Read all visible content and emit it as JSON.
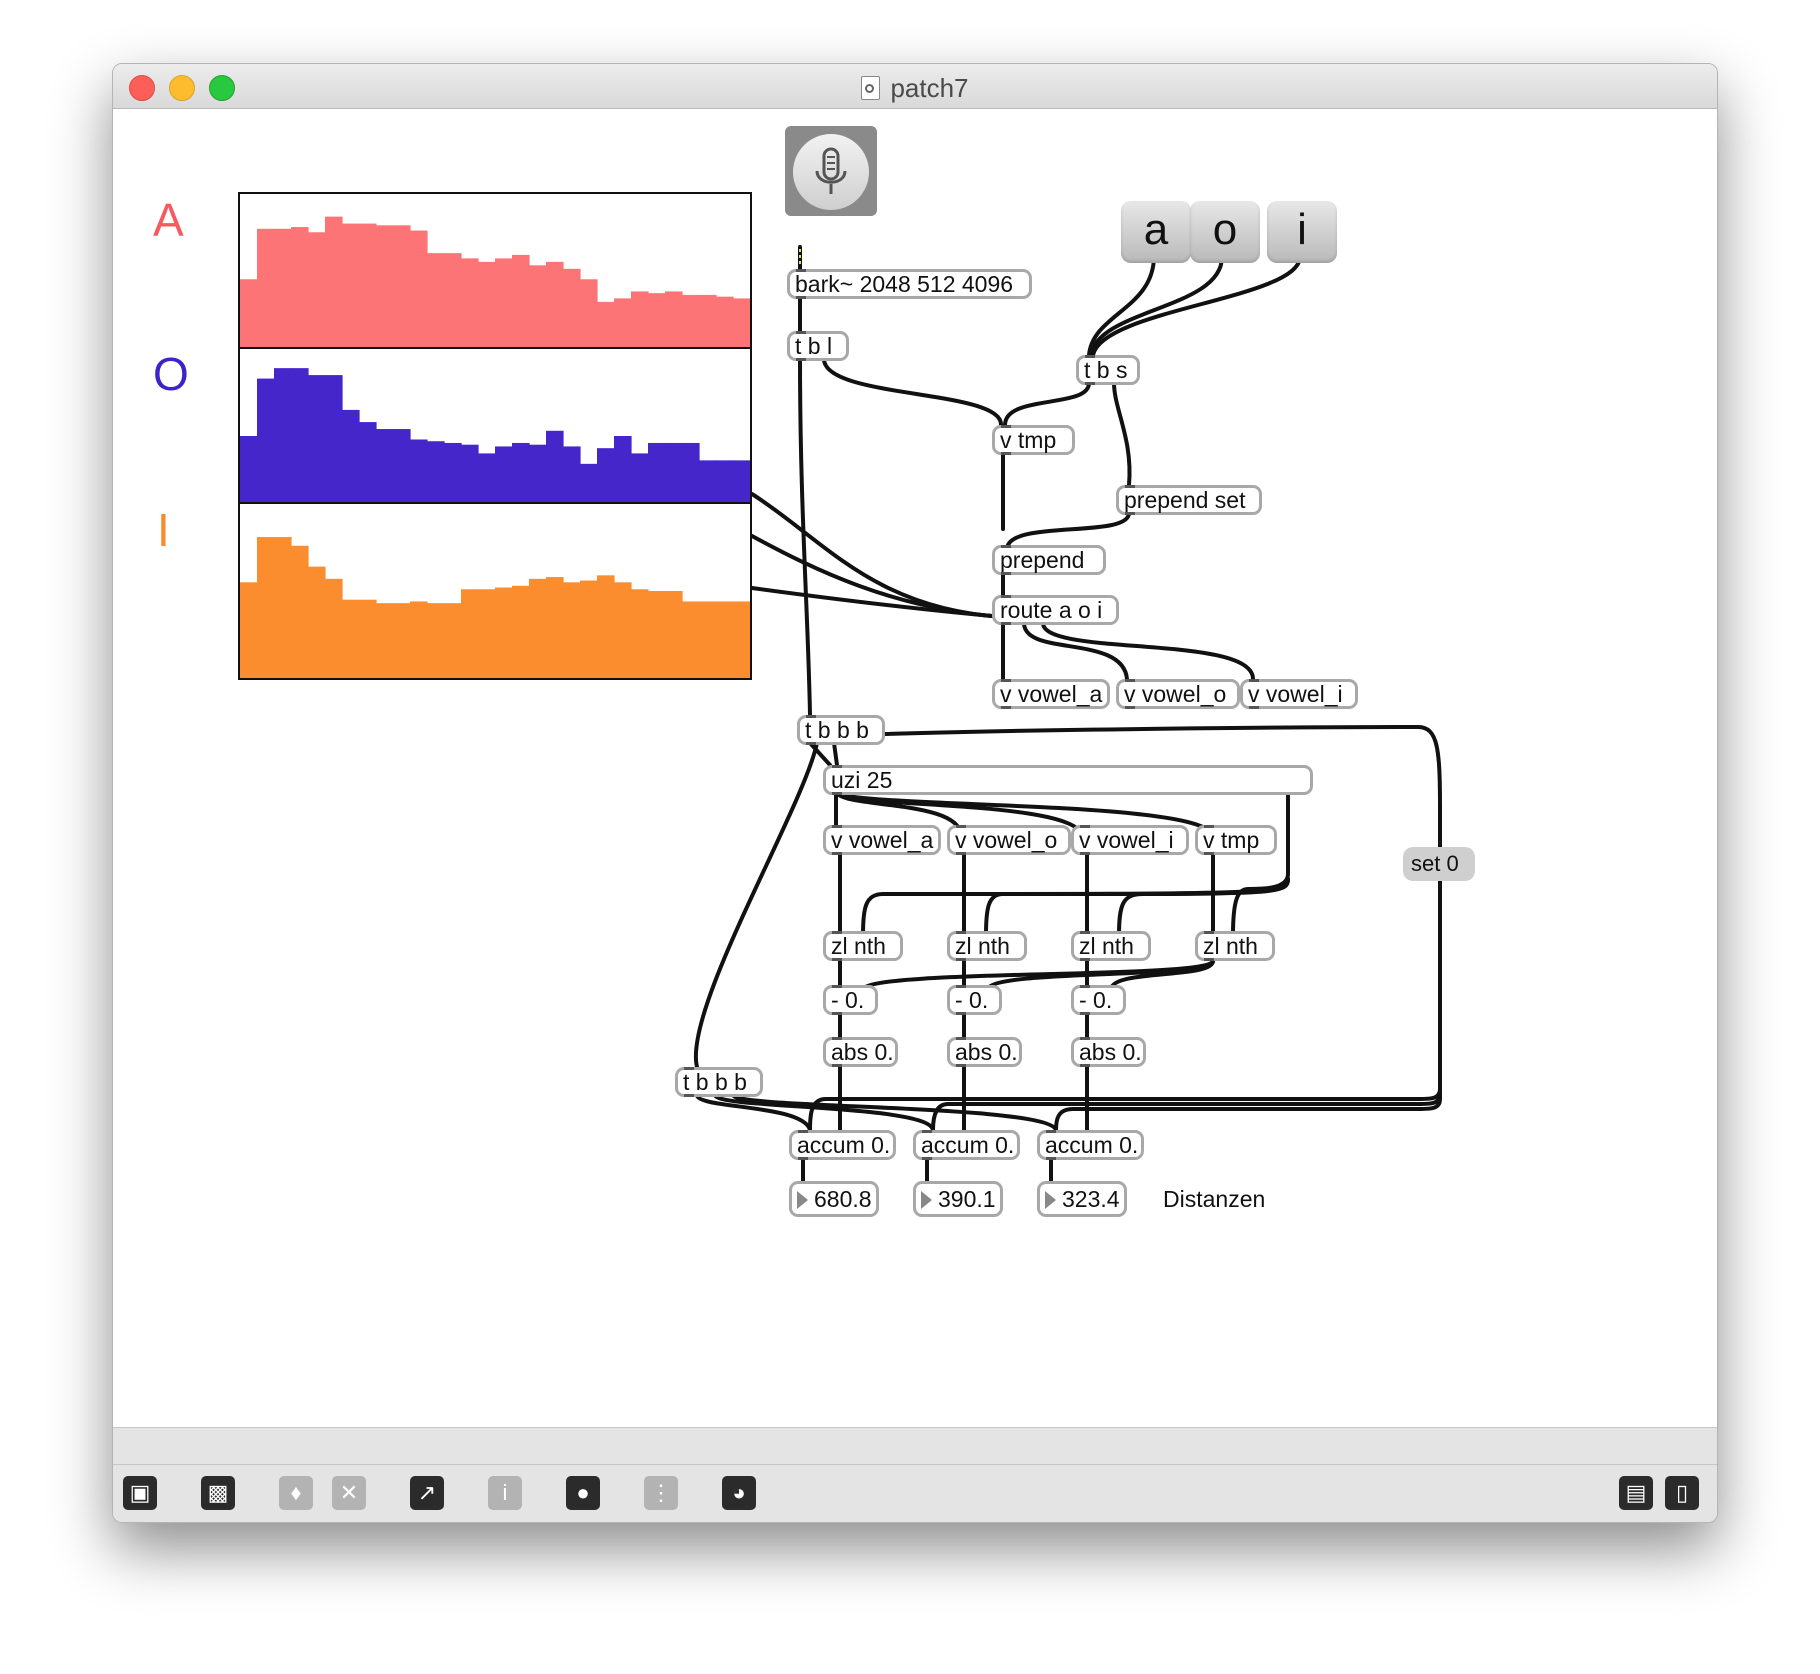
{
  "window": {
    "title": "patch7"
  },
  "vowel_buttons": [
    {
      "label": "a"
    },
    {
      "label": "o"
    },
    {
      "label": "i"
    }
  ],
  "vowel_labels": [
    {
      "text": "A",
      "color": "#f45a5e"
    },
    {
      "text": "O",
      "color": "#3d23c9"
    },
    {
      "text": "I",
      "color": "#f98b2f"
    }
  ],
  "chart_data": [
    {
      "type": "bar",
      "series": [
        {
          "values": [
            0.51,
            0.8,
            0.8,
            0.81,
            0.78,
            0.87,
            0.83,
            0.83,
            0.82,
            0.82,
            0.79,
            0.66,
            0.66,
            0.63,
            0.61,
            0.63,
            0.65,
            0.59,
            0.61,
            0.57,
            0.51,
            0.38,
            0.4,
            0.44,
            0.43,
            0.44,
            0.42,
            0.42,
            0.41,
            0.4
          ]
        }
      ],
      "color": "#fc7476"
    },
    {
      "type": "bar",
      "series": [
        {
          "values": [
            0.5,
            0.83,
            0.89,
            0.89,
            0.85,
            0.85,
            0.65,
            0.58,
            0.54,
            0.54,
            0.48,
            0.47,
            0.46,
            0.45,
            0.4,
            0.44,
            0.46,
            0.45,
            0.53,
            0.44,
            0.34,
            0.43,
            0.5,
            0.4,
            0.46,
            0.46,
            0.46,
            0.36,
            0.36,
            0.36
          ]
        }
      ],
      "color": "#4526cb"
    },
    {
      "type": "bar",
      "series": [
        {
          "values": [
            0.55,
            0.81,
            0.81,
            0.76,
            0.64,
            0.57,
            0.45,
            0.45,
            0.43,
            0.43,
            0.44,
            0.43,
            0.43,
            0.51,
            0.51,
            0.52,
            0.53,
            0.57,
            0.58,
            0.55,
            0.56,
            0.59,
            0.55,
            0.51,
            0.5,
            0.5,
            0.44,
            0.44,
            0.44,
            0.44
          ]
        }
      ],
      "color": "#fb8d2f"
    }
  ],
  "objects": {
    "bark": "bark~ 2048 512 4096",
    "tbl": "t b l",
    "tbs": "t b s",
    "vtmp1": "v tmp",
    "prependset": "prepend set",
    "prepend": "prepend",
    "route": "route a o i",
    "vowel_a1": "v vowel_a",
    "vowel_o1": "v vowel_o",
    "vowel_i1": "v vowel_i",
    "tbbb1": "t b b b",
    "uzi": "uzi 25",
    "vowel_a2": "v vowel_a",
    "vowel_o2": "v vowel_o",
    "vowel_i2": "v vowel_i",
    "vtmp2": "v tmp",
    "zlnth1": "zl nth",
    "zlnth2": "zl nth",
    "zlnth3": "zl nth",
    "zlnth4": "zl nth",
    "minus1": "- 0.",
    "minus2": "- 0.",
    "minus3": "- 0.",
    "abs1": "abs 0.",
    "abs2": "abs 0.",
    "abs3": "abs 0.",
    "tbbb2": "t b b b",
    "accum1": "accum 0.",
    "accum2": "accum 0.",
    "accum3": "accum 0."
  },
  "set0": "set 0",
  "numbers": [
    "680.8",
    "390.1",
    "323.4"
  ],
  "distances_label": "Distanzen",
  "toolbar": [
    "lock-icon",
    "presentation-icon",
    "trash-icon",
    "clear-icon",
    "plot-icon",
    "info-icon",
    "slider-icon",
    "grid-icon",
    "dial-icon",
    "left-panel-icon",
    "right-panel-icon"
  ]
}
